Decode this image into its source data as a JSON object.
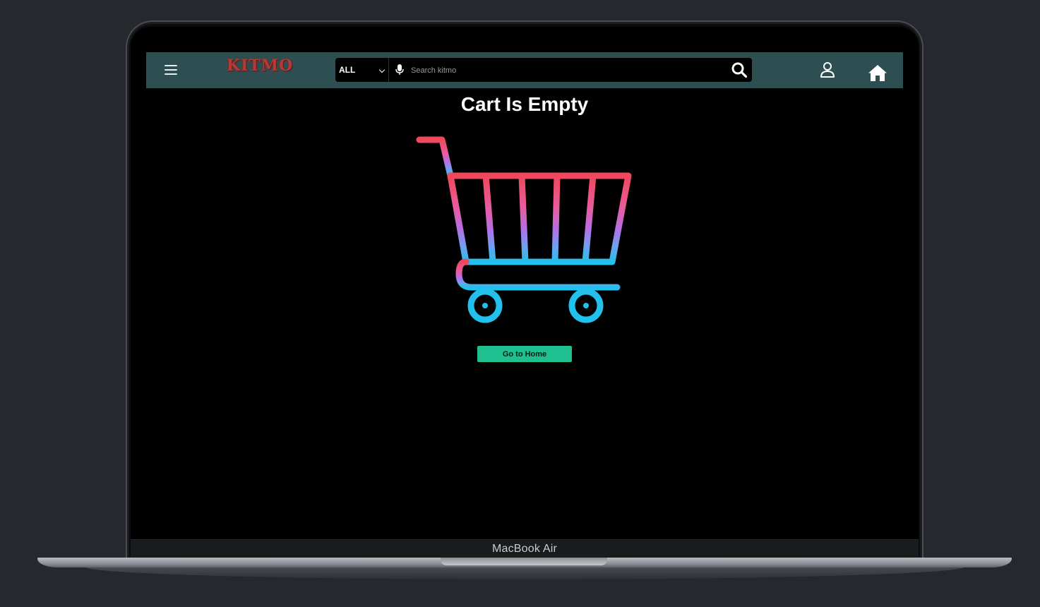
{
  "navbar": {
    "brand": "KITMO",
    "search": {
      "category": "ALL",
      "placeholder": "Search kitmo"
    },
    "icons": [
      "menu-icon",
      "microphone-icon",
      "search-icon",
      "user-icon",
      "home-icon"
    ],
    "background": "#2d4f52"
  },
  "main": {
    "title": "Cart Is Empty",
    "illustration": "shopping-cart-icon",
    "button_label": "Go to Home",
    "button_color": "#1fbf8f"
  },
  "device": {
    "label": "MacBook Air"
  }
}
